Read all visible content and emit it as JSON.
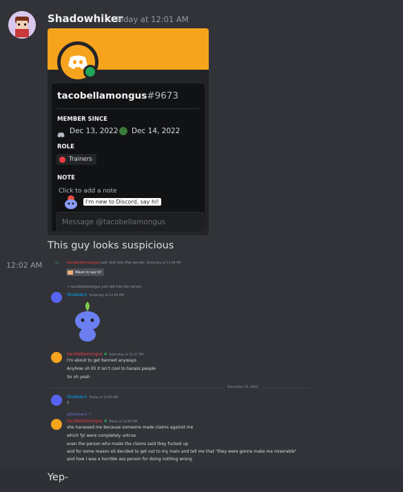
{
  "message": {
    "author": "Shadowhiker",
    "timestamp": "Today at 12:01 AM",
    "caption": "This guy looks suspicious",
    "followup_time": "12:02 AM",
    "followup_text": "Yep-"
  },
  "profile": {
    "username": "tacobellamongus",
    "discriminator": "#9673",
    "member_since_title": "MEMBER SINCE",
    "discord_date": "Dec 13, 2022",
    "server_date": "Dec 14, 2022",
    "role_title": "ROLE",
    "role": "Trainers",
    "note_title": "NOTE",
    "note_placeholder": "Click to add a note",
    "wave_text": "I'm new to Discord, say hi!",
    "message_placeholder": "Message @tacobellamongus",
    "banner_color": "#f6a31d"
  },
  "screenshot": {
    "join1_user": "tacobellamongus",
    "join1_text": "just slid into the server.",
    "join1_time": "Yesterday at 11:09 PM",
    "wave_button": "Wave to say hi!",
    "join2_text": "→ tacobellamongus just slid into the server.",
    "shadow_name": "Shadow.II.",
    "shadow_time": "Yesterday at 11:09 PM",
    "taco_name": "tacobellamongus",
    "taco_time": "Yesterday at 11:37 PM",
    "taco_lines": [
      "I'm about to get banned anyways",
      "Anyhow uh Eli it isn't cool to harass people",
      "So uh yeah"
    ],
    "date_divider": "December 15, 2022",
    "shadow2_name": "Shadow.II.",
    "shadow2_time": "Today at 12:00 AM",
    "shadow2_text": "?",
    "reply_ref": "@Shadow.II. ?",
    "taco2_name": "tacobellamongus",
    "taco2_time": "Today at 12:00 AM",
    "taco2_lines": [
      "she harassed me because someone made claims against me",
      "which fyi were completely untrue",
      "even the person who made the claims said they fucked up",
      "and for some reason eli decided to get out to my main and tell me that \"they were gonna make me miserable\"",
      "and how I was a horrible ass person for doing nothing wrong"
    ]
  }
}
